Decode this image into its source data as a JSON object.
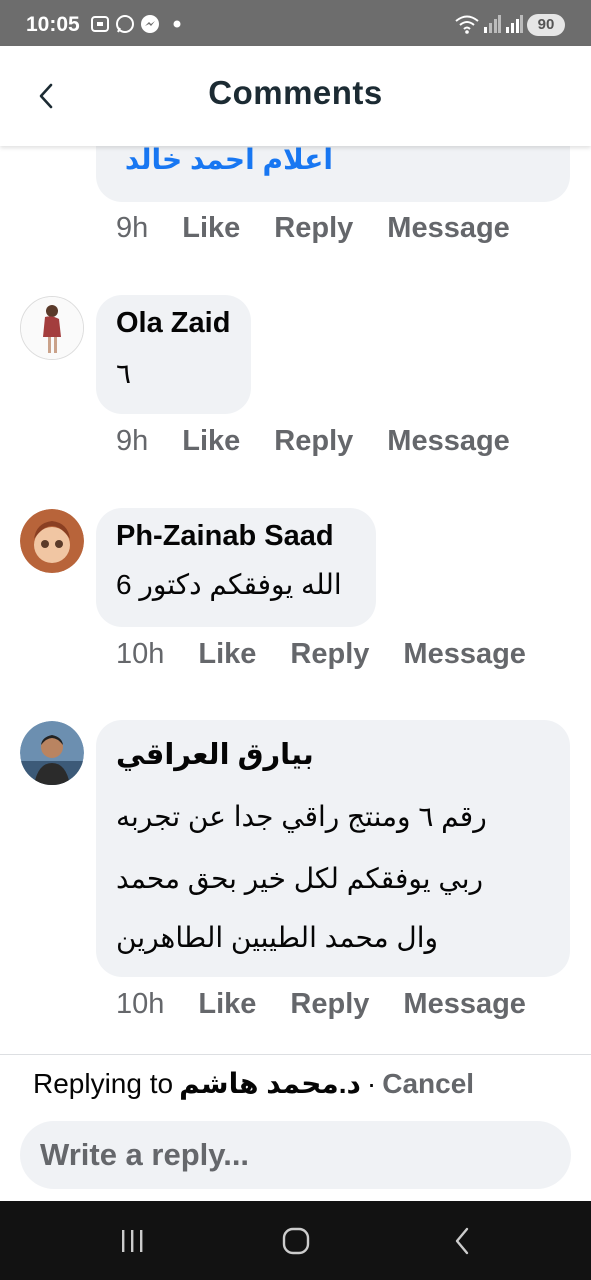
{
  "status_bar": {
    "time": "10:05",
    "battery": "90",
    "left_icons": [
      "screenshot-icon",
      "whatsapp-icon",
      "messenger-icon",
      "dot-icon"
    ],
    "right_icons": [
      "wifi-icon",
      "signal-icon",
      "signal-icon-2"
    ]
  },
  "header": {
    "title": "Comments"
  },
  "partial_comment": {
    "name": "اعلام احمد خالد",
    "time": "9h",
    "like": "Like",
    "reply": "Reply",
    "message": "Message"
  },
  "comments": [
    {
      "name": "Ola Zaid",
      "text": "٦",
      "time": "9h",
      "like": "Like",
      "reply": "Reply",
      "message": "Message"
    },
    {
      "name": "Ph-Zainab Saad",
      "text": "الله يوفقكم دكتور 6",
      "time": "10h",
      "like": "Like",
      "reply": "Reply",
      "message": "Message"
    },
    {
      "name": "بيارق العراقي",
      "text_lines": [
        "رقم ٦ ومنتج راقي جدا عن تجربه",
        "ربي يوفقكم لكل خير بحق محمد",
        "وال محمد الطيبين الطاهرين"
      ],
      "time": "10h",
      "like": "Like",
      "reply": "Reply",
      "message": "Message"
    }
  ],
  "reply_bar": {
    "replying_to": "Replying to",
    "target": "د.محمد هاشم",
    "separator": "·",
    "cancel": "Cancel",
    "placeholder": "Write a reply..."
  },
  "colors": {
    "link_blue": "#1877f2",
    "muted": "#65676b",
    "bubble": "#f0f2f5"
  }
}
